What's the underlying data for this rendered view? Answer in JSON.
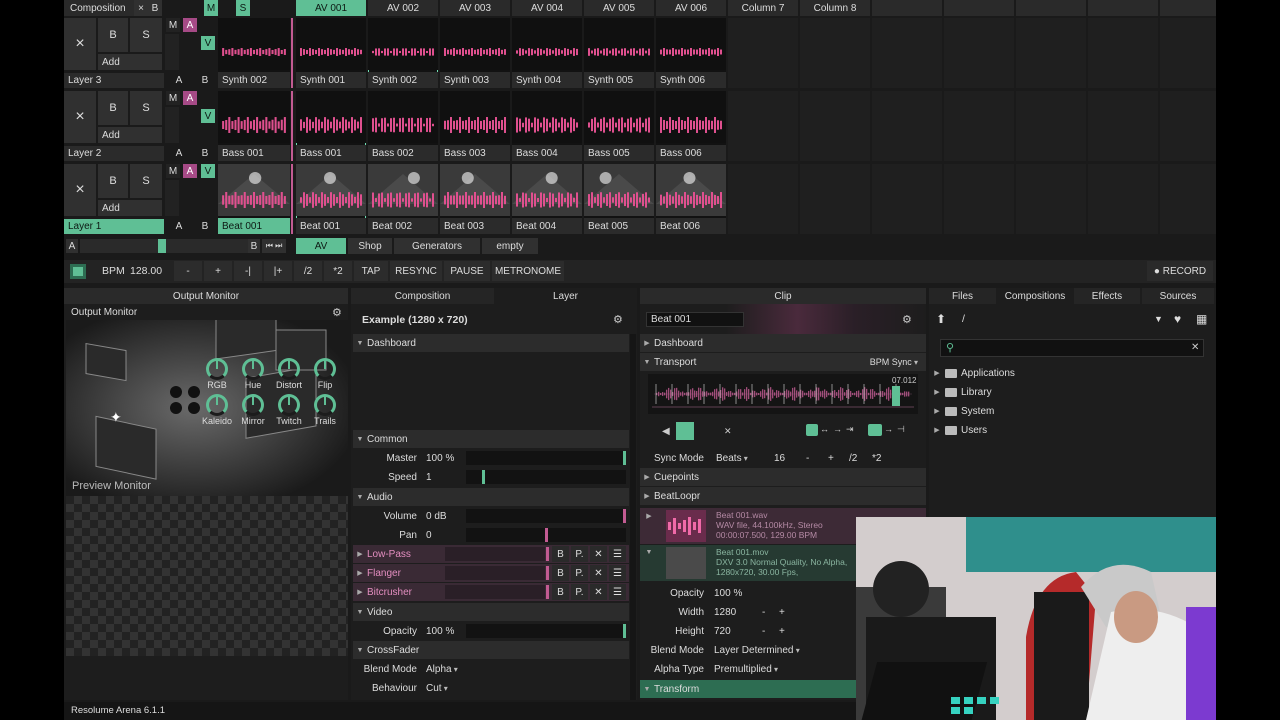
{
  "composition": {
    "menu_label": "Composition",
    "close": "×",
    "b": "B",
    "m": "M",
    "s": "S",
    "columns": [
      "AV 001",
      "AV 002",
      "AV 003",
      "AV 004",
      "AV 005",
      "AV 006",
      "Column 7",
      "Column 8"
    ]
  },
  "layers": [
    {
      "name": "Layer 3",
      "bypass": "B",
      "solo": "S",
      "add": "Add",
      "m": "M",
      "a": "A",
      "v": "V",
      "ab_a": "A",
      "ab_b": "B",
      "clips": [
        "Synth 001",
        "Synth 002",
        "Synth 003",
        "Synth 004",
        "Synth 005",
        "Synth 006"
      ],
      "first": "Synth 002"
    },
    {
      "name": "Layer 2",
      "bypass": "B",
      "solo": "S",
      "add": "Add",
      "m": "M",
      "a": "A",
      "v": "V",
      "ab_a": "A",
      "ab_b": "B",
      "clips": [
        "Bass 001",
        "Bass 002",
        "Bass 003",
        "Bass 004",
        "Bass 005",
        "Bass 006"
      ],
      "first": "Bass 001"
    },
    {
      "name": "Layer 1",
      "bypass": "B",
      "solo": "S",
      "add": "Add",
      "m": "M",
      "a": "A",
      "v": "V",
      "ab_a": "A",
      "ab_b": "B",
      "clips": [
        "Beat 001",
        "Beat 002",
        "Beat 003",
        "Beat 004",
        "Beat 005",
        "Beat 006"
      ],
      "first": "Beat 001"
    }
  ],
  "crossfader": {
    "a": "A",
    "b": "B"
  },
  "deck_tabs": [
    "AV",
    "Shop",
    "Generators",
    "empty"
  ],
  "transport": {
    "bpm_label": "BPM",
    "bpm": "128.00",
    "buttons": [
      "-",
      "+",
      "-|",
      "|+",
      "/2",
      "*2",
      "TAP",
      "RESYNC",
      "PAUSE",
      "METRONOME"
    ],
    "record": "● RECORD"
  },
  "output_panel": {
    "title": "Output Monitor",
    "monitor_label": "Output Monitor",
    "preview_label": "Preview Monitor"
  },
  "layer_panel": {
    "tabs": [
      "Composition",
      "Layer"
    ],
    "title": "Example (1280 x 720)",
    "dashboard": "Dashboard",
    "knobs": [
      "RGB",
      "Hue",
      "Distort",
      "Flip",
      "Kaleido",
      "Mirror",
      "Twitch",
      "Trails"
    ],
    "common": "Common",
    "master_label": "Master",
    "master_value": "100 %",
    "master_level": 1.0,
    "speed_label": "Speed",
    "speed_value": "1",
    "speed_level": 0.1,
    "audio": "Audio",
    "volume_label": "Volume",
    "volume_value": "0 dB",
    "volume_level": 1.0,
    "pan_label": "Pan",
    "pan_value": "0",
    "pan_level": 0.5,
    "effects": [
      "Low-Pass",
      "Flanger",
      "Bitcrusher"
    ],
    "fx_b": "B",
    "fx_p": "P.",
    "fx_x": "✕",
    "fx_menu": "☰",
    "video": "Video",
    "opacity_label": "Opacity",
    "opacity_value": "100 %",
    "opacity_level": 1.0,
    "crossfader": "CrossFader",
    "blend_label": "Blend Mode",
    "blend_value": "Alpha",
    "behaviour_label": "Behaviour",
    "behaviour_value": "Cut"
  },
  "clip_panel": {
    "tab": "Clip",
    "name": "Beat 001",
    "dashboard": "Dashboard",
    "transport": "Transport",
    "bpm_sync": "BPM Sync",
    "time_readout": "07.012",
    "playhead": 0.93,
    "sync_label": "Sync Mode",
    "sync_value": "Beats",
    "beats": "16",
    "beat_buttons": [
      "-",
      "+",
      "/2",
      "*2"
    ],
    "cuepoints": "Cuepoints",
    "beatloopr": "BeatLoopr",
    "audio_file": {
      "name": "Beat 001.wav",
      "line1": "WAV file, 44.100kHz, Stereo",
      "line2": "00:00:07.500, 129.00 BPM"
    },
    "video_file": {
      "name": "Beat 001.mov",
      "line1": "DXV 3.0 Normal Quality, No Alpha,",
      "line2": "1280x720, 30.00 Fps,"
    },
    "opacity_label": "Opacity",
    "opacity_value": "100 %",
    "width_label": "Width",
    "width_value": "1280",
    "height_label": "Height",
    "height_value": "720",
    "blend_label": "Blend Mode",
    "blend_value": "Layer Determined",
    "alpha_label": "Alpha Type",
    "alpha_value": "Premultiplied",
    "transform": "Transform"
  },
  "browser": {
    "tabs": [
      "Files",
      "Compositions",
      "Effects",
      "Sources"
    ],
    "path": "/",
    "folders": [
      "Applications",
      "Library",
      "System",
      "Users"
    ]
  },
  "status": {
    "version": "Resolume Arena 6.1.1"
  },
  "colors": {
    "accent": "#5fbf95",
    "pink": "#e0508f",
    "magenta": "#a64a86"
  }
}
